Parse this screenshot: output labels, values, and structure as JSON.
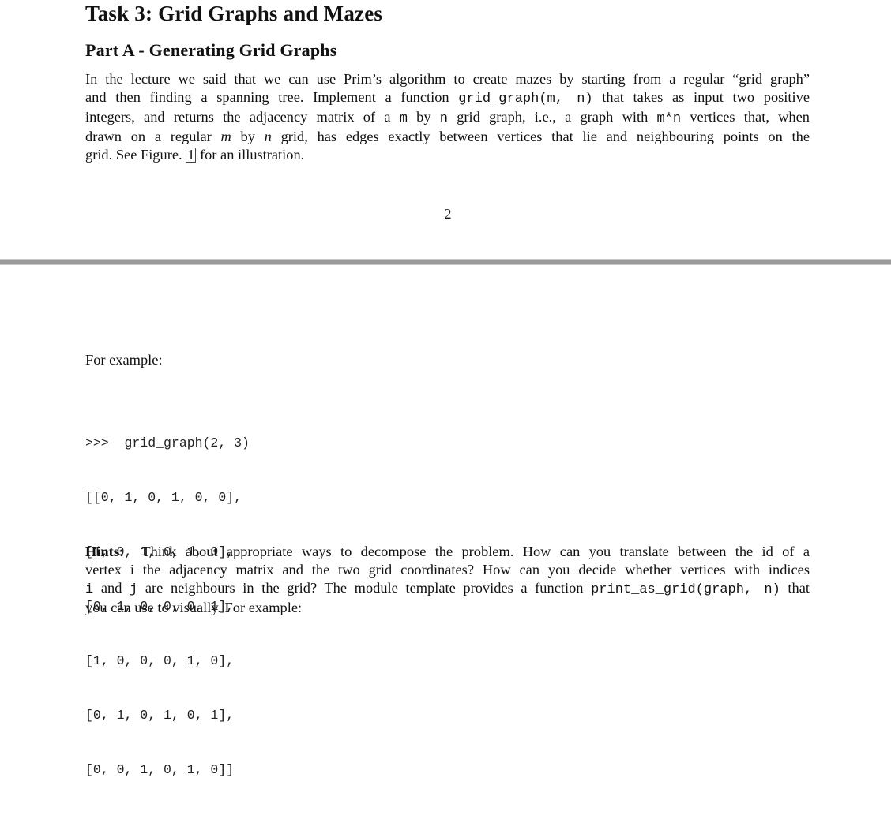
{
  "page1": {
    "title": "Task 3: Grid Graphs and Mazes",
    "subtitle": "Part A - Generating Grid Graphs",
    "intro": {
      "l1": "In the lecture we said that we can use Prim’s algorithm to create mazes by starting from a regular “grid graph”",
      "l2a": "and then finding a spanning tree. Implement a function ",
      "l2code": "grid_graph(m, n)",
      "l2b": " that takes as input two positive",
      "l3a": "integers, and returns the adjacency matrix of a ",
      "l3m": "m",
      "l3b": " by ",
      "l3n": "n",
      "l3c": " grid graph, i.e., a graph with ",
      "l3mn": "m*n",
      "l3d": " vertices that, when",
      "l4a": "drawn on a regular ",
      "l4m": "m",
      "l4b": " by ",
      "l4n": "n",
      "l4c": " grid, has edges exactly between vertices that lie and neighbouring points on the",
      "l5a": "grid. See Figure. ",
      "l5ref": "1",
      "l5b": " for an illustration."
    },
    "page_number": "2"
  },
  "page2": {
    "example_label": "For example:",
    "code_lines": [
      ">>>  grid_graph(2, 3)",
      "[[0, 1, 0, 1, 0, 0],",
      "[1, 0, 1, 0, 1, 0],",
      "[0, 1, 0, 0, 0, 1],",
      "[1, 0, 0, 0, 1, 0],",
      "[0, 1, 0, 1, 0, 1],",
      "[0, 0, 1, 0, 1, 0]]"
    ],
    "hints": {
      "label": "Hints:",
      "l1": "  Think about appropriate ways to decompose the problem. How can you translate between the id of a",
      "l2": "vertex i the adjacency matrix and the two grid coordinates? How can you decide whether vertices with indices",
      "l3i": "i",
      "l3a": " and ",
      "l3j": "j",
      "l3b": " are neighbours in the grid? The module template provides a function ",
      "l3code": "print_as_grid(graph, n)",
      "l3c": " that",
      "l4": "you can use to visually. For example:"
    }
  }
}
